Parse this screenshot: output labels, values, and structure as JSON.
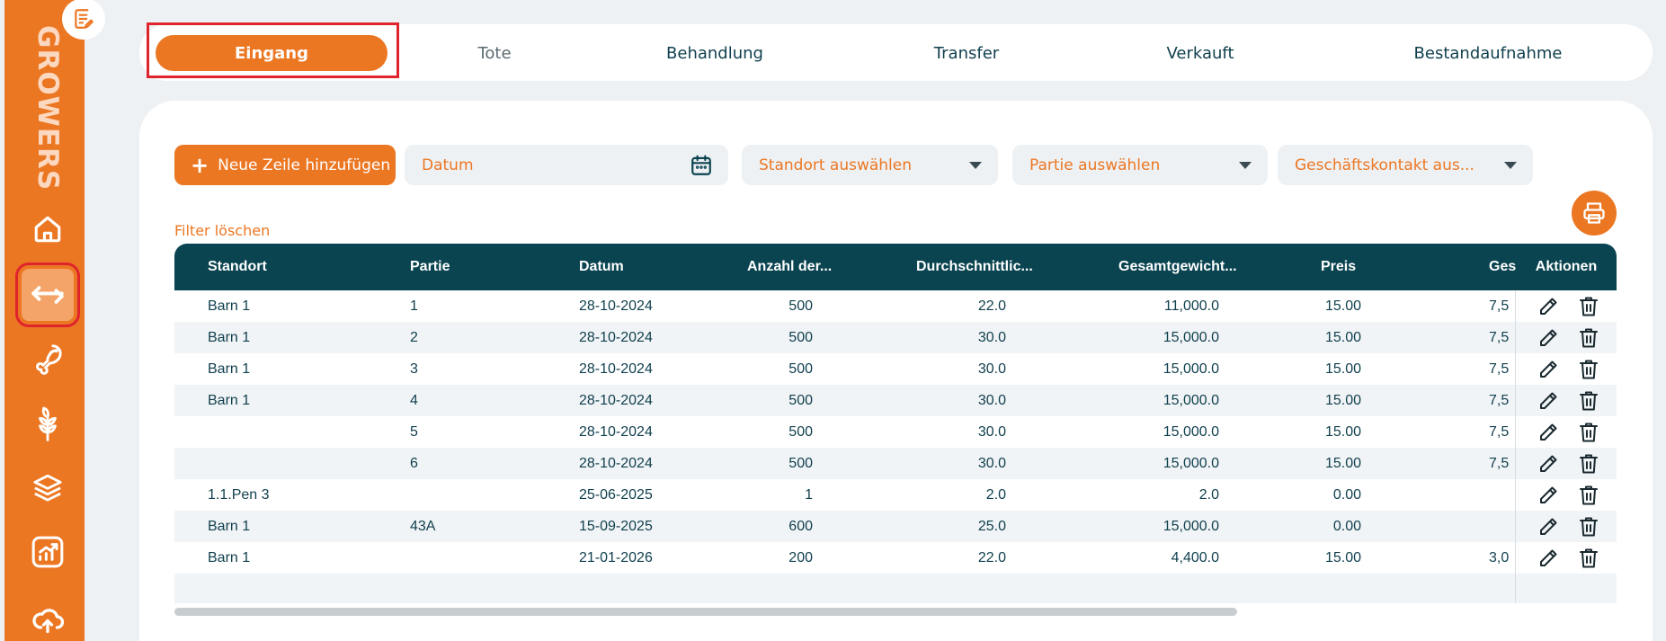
{
  "sidebar": {
    "brand": "GROWERS",
    "items": [
      {
        "icon": "home-icon"
      },
      {
        "icon": "transfer-arrows-icon",
        "active": true
      },
      {
        "icon": "drumstick-icon"
      },
      {
        "icon": "wheat-icon"
      },
      {
        "icon": "layers-icon"
      },
      {
        "icon": "chart-icon"
      },
      {
        "icon": "cloud-upload-icon"
      }
    ]
  },
  "tabs": [
    {
      "label": "Eingang",
      "active": true
    },
    {
      "label": "Tote"
    },
    {
      "label": "Behandlung"
    },
    {
      "label": "Transfer"
    },
    {
      "label": "Verkauft"
    },
    {
      "label": "Bestandaufnahme"
    }
  ],
  "toolbar": {
    "add_label": "Neue Zeile hinzufügen",
    "date_placeholder": "Datum",
    "location_placeholder": "Standort auswählen",
    "batch_placeholder": "Partie auswählen",
    "contact_placeholder": "Geschäftskontakt aus...",
    "clear_filter": "Filter löschen"
  },
  "table": {
    "headers": [
      "Standort",
      "Partie",
      "Datum",
      "Anzahl der...",
      "Durchschnittlic...",
      "Gesamtgewicht...",
      "Preis",
      "Ges"
    ],
    "actions_header": "Aktionen",
    "rows": [
      [
        "Barn 1",
        "1",
        "28-10-2024",
        "500",
        "22.0",
        "11,000.0",
        "15.00",
        "7,5"
      ],
      [
        "Barn 1",
        "2",
        "28-10-2024",
        "500",
        "30.0",
        "15,000.0",
        "15.00",
        "7,5"
      ],
      [
        "Barn 1",
        "3",
        "28-10-2024",
        "500",
        "30.0",
        "15,000.0",
        "15.00",
        "7,5"
      ],
      [
        "Barn 1",
        "4",
        "28-10-2024",
        "500",
        "30.0",
        "15,000.0",
        "15.00",
        "7,5"
      ],
      [
        "",
        "5",
        "28-10-2024",
        "500",
        "30.0",
        "15,000.0",
        "15.00",
        "7,5"
      ],
      [
        "",
        "6",
        "28-10-2024",
        "500",
        "30.0",
        "15,000.0",
        "15.00",
        "7,5"
      ],
      [
        "1.1.Pen 3",
        "",
        "25-06-2025",
        "1",
        "2.0",
        "2.0",
        "0.00",
        ""
      ],
      [
        "Barn 1",
        "43A",
        "15-09-2025",
        "600",
        "25.0",
        "15,000.0",
        "0.00",
        ""
      ],
      [
        "Barn 1",
        "",
        "21-01-2026",
        "200",
        "22.0",
        "4,400.0",
        "15.00",
        "3,0"
      ]
    ]
  },
  "colors": {
    "accent": "#ec7723",
    "header": "#0a4451",
    "text": "#0f3f4d",
    "highlight": "#e0242c"
  }
}
